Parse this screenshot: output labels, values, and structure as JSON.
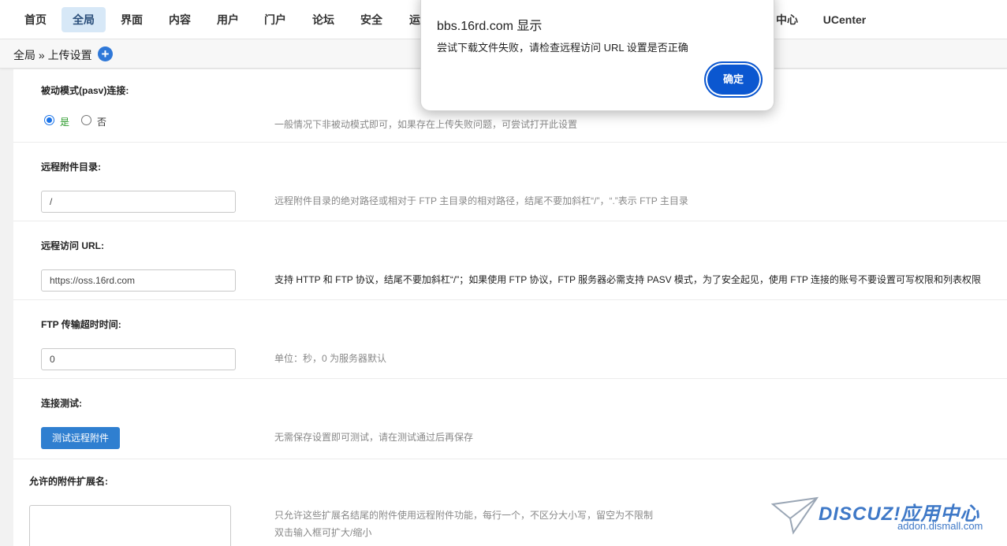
{
  "nav": {
    "items": [
      "首页",
      "全局",
      "界面",
      "内容",
      "用户",
      "门户",
      "论坛",
      "安全",
      "运",
      "中心",
      "UCenter"
    ],
    "active_index": 1
  },
  "breadcrumb": {
    "text": "全局 » 上传设置",
    "add_icon": "plus-circle-icon"
  },
  "form": {
    "pasv": {
      "label": "被动模式(pasv)连接:",
      "options": [
        "是",
        "否"
      ],
      "selected": "是",
      "hint": "一般情况下非被动模式即可，如果存在上传失败问题，可尝试打开此设置"
    },
    "remote_dir": {
      "label": "远程附件目录:",
      "value": "/",
      "hint": "远程附件目录的绝对路径或相对于 FTP 主目录的相对路径，结尾不要加斜杠“/”，“.”表示 FTP 主目录"
    },
    "remote_url": {
      "label": "远程访问 URL:",
      "value": "https://oss.16rd.com",
      "hint": "支持 HTTP 和 FTP 协议，结尾不要加斜杠“/”；如果使用 FTP 协议，FTP 服务器必需支持 PASV 模式，为了安全起见，使用 FTP 连接的账号不要设置可写权限和列表权限"
    },
    "timeout": {
      "label": "FTP 传输超时时间:",
      "value": "0",
      "hint": "单位：秒，0 为服务器默认"
    },
    "test": {
      "label": "连接测试:",
      "button": "测试远程附件",
      "hint": "无需保存设置即可测试，请在测试通过后再保存"
    },
    "allowed_ext": {
      "label": "允许的附件扩展名:",
      "hint1": "只允许这些扩展名结尾的附件使用远程附件功能，每行一个，不区分大小写，留空为不限制",
      "hint2": "双击输入框可扩大/缩小"
    }
  },
  "dialog": {
    "title": "bbs.16rd.com 显示",
    "message": "尝试下载文件失败，请检查远程访问 URL 设置是否正确",
    "ok_label": "确定"
  },
  "watermark": {
    "brand": "DISCUZ!应用中心",
    "url": "addon.dismall.com"
  },
  "colors": {
    "accent": "#2f7fd0",
    "dialog_button": "#0b57d0",
    "active_nav_bg": "#d7e8f7"
  }
}
